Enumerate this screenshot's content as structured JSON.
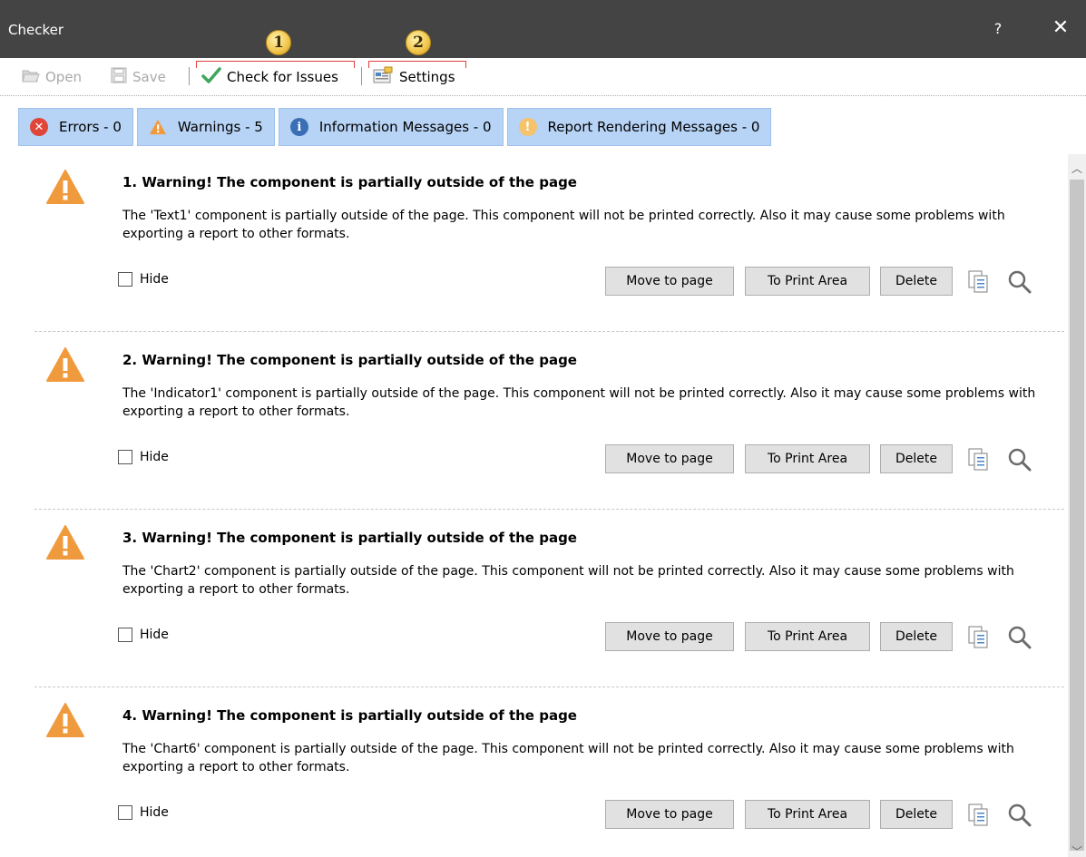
{
  "window": {
    "title": "Checker",
    "help_label": "?",
    "close_label": "✕"
  },
  "toolbar": {
    "open_label": "Open",
    "save_label": "Save",
    "check_label": "Check for Issues",
    "settings_label": "Settings",
    "callouts": [
      "1",
      "2"
    ]
  },
  "tabs": [
    {
      "label": "Errors - 0",
      "icon": "error-icon",
      "color": "#e0453a",
      "glyph": "✕"
    },
    {
      "label": "Warnings - 5",
      "icon": "warning-icon",
      "color": "#f09a3e",
      "glyph": "!"
    },
    {
      "label": "Information Messages - 0",
      "icon": "info-icon",
      "color": "#3b6fb5",
      "glyph": "i"
    },
    {
      "label": "Report Rendering Messages - 0",
      "icon": "rendering-message-icon",
      "color": "#f5c36a",
      "glyph": "!"
    }
  ],
  "items": [
    {
      "title": "1. Warning! The component is partially outside of the page",
      "description": "The 'Text1' component is partially outside of the page. This component will not be printed correctly. Also it may cause some problems with exporting a report to other formats.",
      "hide_label": "Hide",
      "move_label": "Move to page",
      "print_area_label": "To Print Area",
      "delete_label": "Delete"
    },
    {
      "title": "2. Warning! The component is partially outside of the page",
      "description": "The 'Indicator1' component is partially outside of the page. This component will not be printed correctly. Also it may cause some problems with exporting a report to other formats.",
      "hide_label": "Hide",
      "move_label": "Move to page",
      "print_area_label": "To Print Area",
      "delete_label": "Delete"
    },
    {
      "title": "3. Warning! The component is partially outside of the page",
      "description": "The 'Chart2' component is partially outside of the page. This component will not be printed correctly. Also it may cause some problems with exporting a report to other formats.",
      "hide_label": "Hide",
      "move_label": "Move to page",
      "print_area_label": "To Print Area",
      "delete_label": "Delete"
    },
    {
      "title": "4. Warning! The component is partially outside of the page",
      "description": "The 'Chart6' component is partially outside of the page. This component will not be printed correctly. Also it may cause some problems with exporting a report to other formats.",
      "hide_label": "Hide",
      "move_label": "Move to page",
      "print_area_label": "To Print Area",
      "delete_label": "Delete"
    }
  ],
  "colors": {
    "titlebar": "#444444",
    "tab_background": "#b7d3f5",
    "warning": "#f09a3e",
    "check": "#3fa65a",
    "callout_border": "#e04040"
  }
}
